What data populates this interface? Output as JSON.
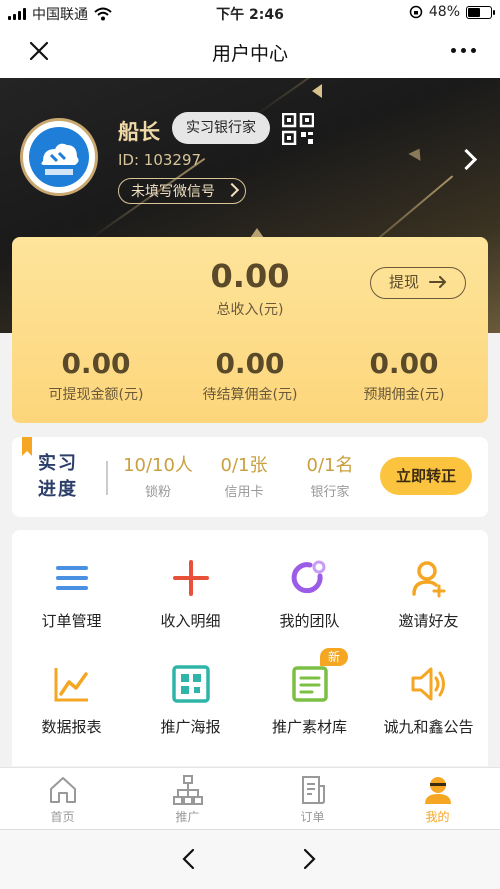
{
  "status": {
    "carrier": "中国联通",
    "time": "下午 2:46",
    "battery": "48%",
    "battery_level": 0.48
  },
  "nav": {
    "title": "用户中心"
  },
  "profile": {
    "name": "船长",
    "role": "实习银行家",
    "id": "ID: 103297",
    "wechat": "未填写微信号"
  },
  "income": {
    "total_amount": "0.00",
    "total_label": "总收入(元)",
    "withdraw_label": "提现",
    "cols": [
      {
        "value": "0.00",
        "label": "可提现金额(元)"
      },
      {
        "value": "0.00",
        "label": "待结算佣金(元)"
      },
      {
        "value": "0.00",
        "label": "预期佣金(元)"
      }
    ]
  },
  "progress": {
    "title": "实习进度",
    "stats": [
      {
        "value": "10/10人",
        "label": "锁粉"
      },
      {
        "value": "0/1张",
        "label": "信用卡"
      },
      {
        "value": "0/1名",
        "label": "银行家"
      }
    ],
    "convert_label": "立即转正"
  },
  "menu": [
    {
      "label": "订单管理",
      "icon": "list-icon",
      "color": "#4a90e2"
    },
    {
      "label": "收入明细",
      "icon": "plus-icon",
      "color": "#e8503a"
    },
    {
      "label": "我的团队",
      "icon": "team-icon",
      "color": "#9b5de5"
    },
    {
      "label": "邀请好友",
      "icon": "add-user-icon",
      "color": "#f5a623"
    },
    {
      "label": "数据报表",
      "icon": "chart-icon",
      "color": "#f5a623"
    },
    {
      "label": "推广海报",
      "icon": "qr-icon",
      "color": "#2fb5a8"
    },
    {
      "label": "推广素材库",
      "icon": "document-icon",
      "color": "#7bc043",
      "badge": "新"
    },
    {
      "label": "诚九和鑫公告",
      "icon": "speaker-icon",
      "color": "#f5a623"
    }
  ],
  "tabs": [
    {
      "label": "首页",
      "icon": "home-icon"
    },
    {
      "label": "推广",
      "icon": "org-chart-icon"
    },
    {
      "label": "订单",
      "icon": "order-icon"
    },
    {
      "label": "我的",
      "icon": "profile-icon",
      "active": true
    }
  ]
}
